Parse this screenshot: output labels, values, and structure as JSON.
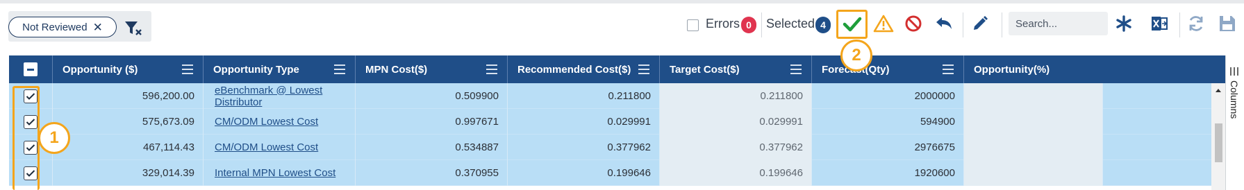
{
  "filter": {
    "chip_label": "Not Reviewed",
    "chip_close": "✕"
  },
  "toolbar": {
    "errors_label": "Errors",
    "errors_count": "0",
    "selected_label": "Selected",
    "selected_count": "4",
    "search_placeholder": "Search..."
  },
  "callouts": {
    "one": "1",
    "two": "2"
  },
  "grid": {
    "columns": [
      "Opportunity ($)",
      "Opportunity Type",
      "MPN Cost($)",
      "Recommended Cost($)",
      "Target Cost($)",
      "Forecast(Qty)",
      "Opportunity(%)"
    ],
    "rows": [
      {
        "opportunity": "596,200.00",
        "type": "eBenchmark @ Lowest Distributor",
        "mpn_cost": "0.509900",
        "recommended": "0.211800",
        "target": "0.211800",
        "forecast": "2000000",
        "pct": ""
      },
      {
        "opportunity": "575,673.09",
        "type": "CM/ODM Lowest Cost",
        "mpn_cost": "0.997671",
        "recommended": "0.029991",
        "target": "0.029991",
        "forecast": "594900",
        "pct": ""
      },
      {
        "opportunity": "467,114.43",
        "type": "CM/ODM Lowest Cost",
        "mpn_cost": "0.534887",
        "recommended": "0.377962",
        "target": "0.377962",
        "forecast": "2976675",
        "pct": ""
      },
      {
        "opportunity": "329,014.39",
        "type": "Internal MPN Lowest Cost",
        "mpn_cost": "0.370955",
        "recommended": "0.199646",
        "target": "0.199646",
        "forecast": "1920600",
        "pct": ""
      }
    ]
  },
  "side_panel": {
    "columns_label": "Columns"
  },
  "colors": {
    "header_bg": "#1f4e88",
    "row_bg": "#b9def6",
    "highlight": "#f4a51c",
    "error_badge": "#e0344f",
    "selected_badge": "#1f4e88",
    "approve": "#1f9e3a",
    "warning": "#f4a51c",
    "reject": "#d32f2f"
  },
  "icons": {
    "funnel": "clear-filter-icon",
    "approve": "checkmark-icon",
    "warning": "warning-icon",
    "reject": "no-entry-icon",
    "reply": "undo-icon",
    "edit": "pencil-icon",
    "asterisk": "asterisk-icon",
    "excel": "excel-export-icon",
    "refresh": "refresh-icon",
    "save": "save-icon"
  }
}
